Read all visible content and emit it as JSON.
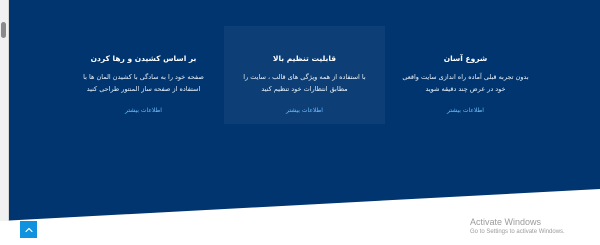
{
  "colors": {
    "hero_dark": "#00356f",
    "hero_mid": "#003a78",
    "accent": "#1192de",
    "link": "#6fbfff"
  },
  "features": [
    {
      "title": "شروع آسان",
      "description": "بدون تجربه قبلی آماده راه اندازی سایت واقعی خود در عرض چند دقیقه شوید",
      "link": "اطلاعات بیشتر"
    },
    {
      "title": "قابلیت تنظیم بالا",
      "description": "با استفاده از همه ویژگی های قالب ، سایت را مطابق انتظارات خود تنظیم کنید",
      "link": "اطلاعات بیشتر"
    },
    {
      "title": "بر اساس کشیدن و رها کردن",
      "description": "صفحه خود را به سادگی با کشیدن المان ها با استفاده از صفحه ساز المنتور طراحی کنید",
      "link": "اطلاعات بیشتر"
    }
  ],
  "back_to_top": {
    "icon": "chevron-up-icon"
  },
  "activation": {
    "title": "Activate Windows",
    "subtitle": "Go to Settings to activate Windows."
  }
}
